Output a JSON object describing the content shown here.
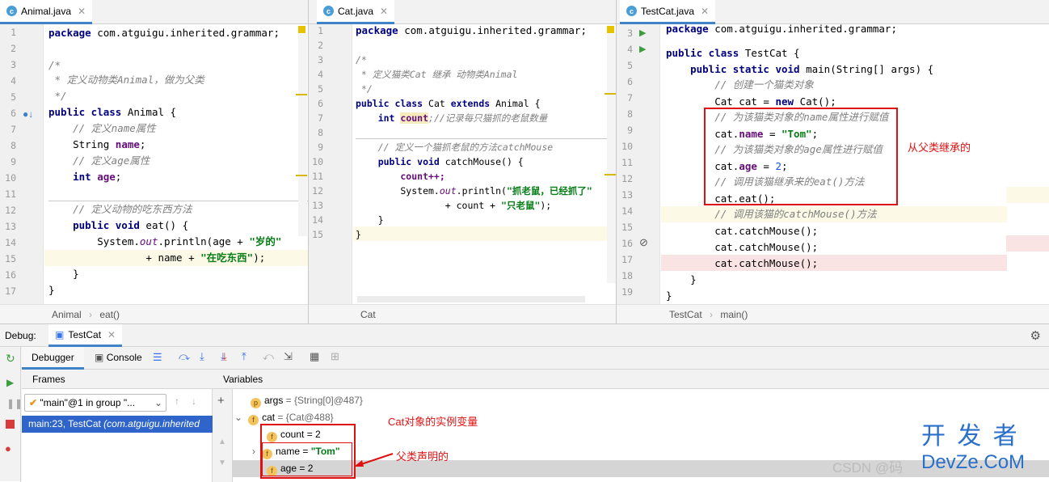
{
  "editor1": {
    "tab": "Animal.java",
    "lines": [
      "1",
      "2",
      "3",
      "4",
      "5",
      "6",
      "7",
      "8",
      "9",
      "10",
      "11",
      "12",
      "13",
      "14",
      "15",
      "16",
      "17"
    ],
    "code": {
      "l1_kw": "package",
      "l1_rest": " com.atguigu.inherited.grammar;",
      "l3": "/*",
      "l4": " * 定义动物类Animal，做为父类",
      "l5": " */",
      "l6_kw": "public class",
      "l6_rest": " Animal {",
      "l7": "    // 定义name属性",
      "l8_a": "    String ",
      "l8_f": "name",
      "l8_b": ";",
      "l9": "    // 定义age属性",
      "l10_kw": "    int ",
      "l10_f": "age",
      "l10_b": ";",
      "l12": "    // 定义动物的吃东西方法",
      "l13_kw": "    public void",
      "l13_rest": " eat() {",
      "l14_a": "        System.",
      "l14_st": "out",
      "l14_b": ".println(age + ",
      "l14_s": "\"岁的\"",
      "l15_a": "                + name + ",
      "l15_s": "\"在吃东西\"",
      "l15_b": ");",
      "l16": "    }",
      "l17": "}"
    },
    "breadcrumb_a": "Animal",
    "breadcrumb_b": "eat()"
  },
  "editor2": {
    "tab": "Cat.java",
    "lines": [
      "1",
      "2",
      "3",
      "4",
      "5",
      "6",
      "7",
      "8",
      "9",
      "10",
      "11",
      "12",
      "13",
      "14",
      "15"
    ],
    "code": {
      "l1_kw": "package",
      "l1_rest": " com.atguigu.inherited.grammar;",
      "l3": "/*",
      "l4": " * 定义猫类Cat 继承 动物类Animal",
      "l5": " */",
      "l6_kw": "public class",
      "l6_mid": " Cat ",
      "l6_kw2": "extends",
      "l6_rest": " Animal {",
      "l7_kw": "    int ",
      "l7_f": "count",
      "l7_cm": ";//记录每只猫抓的老鼠数量",
      "l9": "    // 定义一个猫抓老鼠的方法catchMouse",
      "l10_kw": "    public void",
      "l10_rest": " catchMouse() {",
      "l11": "        count++;",
      "l12_a": "        System.",
      "l12_st": "out",
      "l12_b": ".println(",
      "l12_s": "\"抓老鼠，已经抓了\"",
      "l13_a": "                + count + ",
      "l13_s": "\"只老鼠\"",
      "l13_b": ");",
      "l14": "    }",
      "l15": "}"
    },
    "breadcrumb": "Cat"
  },
  "editor3": {
    "tab": "TestCat.java",
    "lines": [
      "3",
      "4",
      "5",
      "6",
      "7",
      "8",
      "9",
      "10",
      "11",
      "12",
      "13",
      "14",
      "15",
      "16",
      "17",
      "18",
      "19"
    ],
    "code": {
      "l3_kw": "package",
      "l3_rest": " com.atguigu.inherited.grammar;",
      "l5_kw": "public class",
      "l5_rest": " TestCat {",
      "l6_kw": "    public static void",
      "l6_rest": " main(String[] args) {",
      "l7": "        // 创建一个猫类对象",
      "l8_a": "        Cat cat = ",
      "l8_kw": "new",
      "l8_b": " Cat();",
      "l9": "        // 为该猫类对象的name属性进行赋值",
      "l10_a": "        cat.",
      "l10_f": "name",
      "l10_b": " = ",
      "l10_s": "\"Tom\"",
      "l10_c": ";",
      "l11": "        // 为该猫类对象的age属性进行赋值",
      "l12_a": "        cat.",
      "l12_f": "age",
      "l12_b": " = ",
      "l12_n": "2",
      "l12_c": ";",
      "l13": "        // 调用该猫继承来的eat()方法",
      "l14": "        cat.eat();",
      "l15": "        // 调用该猫的catchMouse()方法",
      "l16": "        cat.catchMouse();",
      "l17": "        cat.catchMouse();",
      "l18": "        cat.catchMouse();",
      "l19": "    }",
      "l20": "}"
    },
    "annotation": "从父类继承的",
    "breadcrumb_a": "TestCat",
    "breadcrumb_b": "main()"
  },
  "debug": {
    "label": "Debug:",
    "config": "TestCat",
    "tab_debugger": "Debugger",
    "tab_console": "Console",
    "frames_label": "Frames",
    "variables_label": "Variables",
    "thread": "\"main\"@1 in group \"...",
    "frame_a": "main:23, TestCat ",
    "frame_b": "(com.atguigu.inherited",
    "vars": {
      "args_name": "args",
      "args_val": " = {String[0]@487}",
      "cat_name": "cat",
      "cat_val": " = {Cat@488}",
      "count_name": "count",
      "count_val": " = 2",
      "name_name": "name",
      "name_eq": " = ",
      "name_val": "\"Tom\"",
      "age_name": "age",
      "age_val": " = 2"
    },
    "annotation_instance": "Cat对象的实例变量",
    "annotation_parent": "父类声明的"
  },
  "watermark": {
    "big": "开 发 者",
    "small": "DevZe.CoM",
    "csdn": "CSDN @码"
  }
}
